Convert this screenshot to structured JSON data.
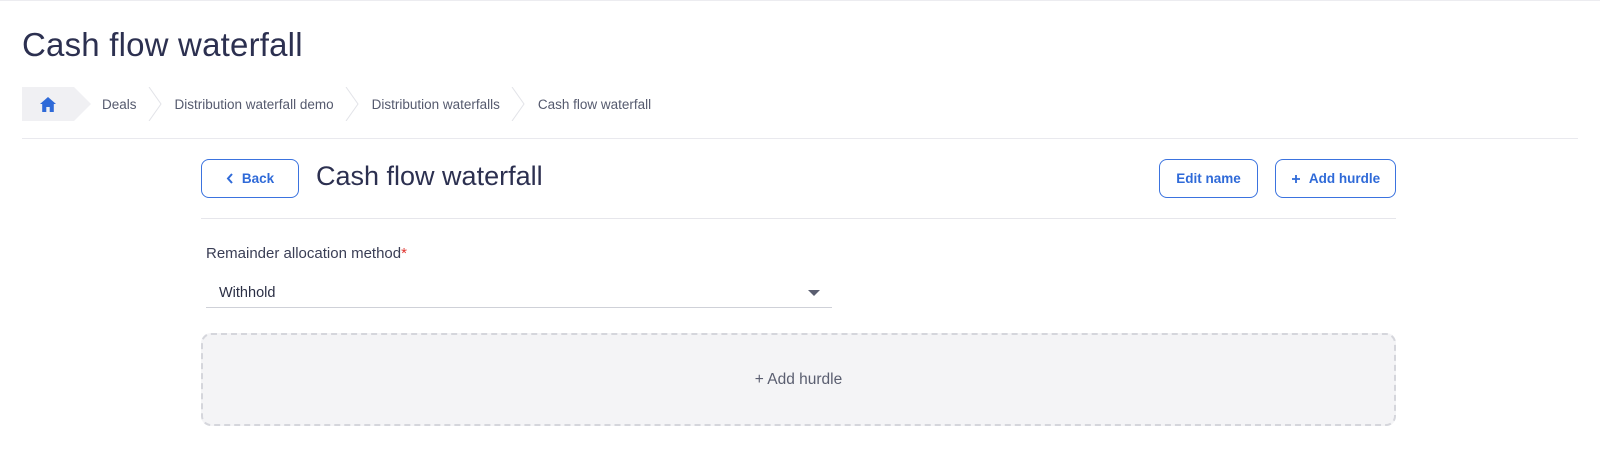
{
  "page": {
    "title": "Cash flow waterfall"
  },
  "breadcrumb": {
    "home_icon": "home-icon",
    "items": [
      "Deals",
      "Distribution waterfall demo",
      "Distribution waterfalls",
      "Cash flow waterfall"
    ]
  },
  "header": {
    "back_label": "Back",
    "back_icon": "chevron-left-icon",
    "title": "Cash flow waterfall",
    "edit_name_label": "Edit name",
    "add_hurdle_label": "Add hurdle",
    "add_hurdle_icon": "plus-icon"
  },
  "form": {
    "remainder_label": "Remainder allocation method",
    "required_mark": "*",
    "remainder_value": "Withhold"
  },
  "hurdles": {
    "add_label": "+ Add hurdle"
  },
  "colors": {
    "accent": "#2f6ad8",
    "required": "#e0342f",
    "title": "#2c3050"
  }
}
